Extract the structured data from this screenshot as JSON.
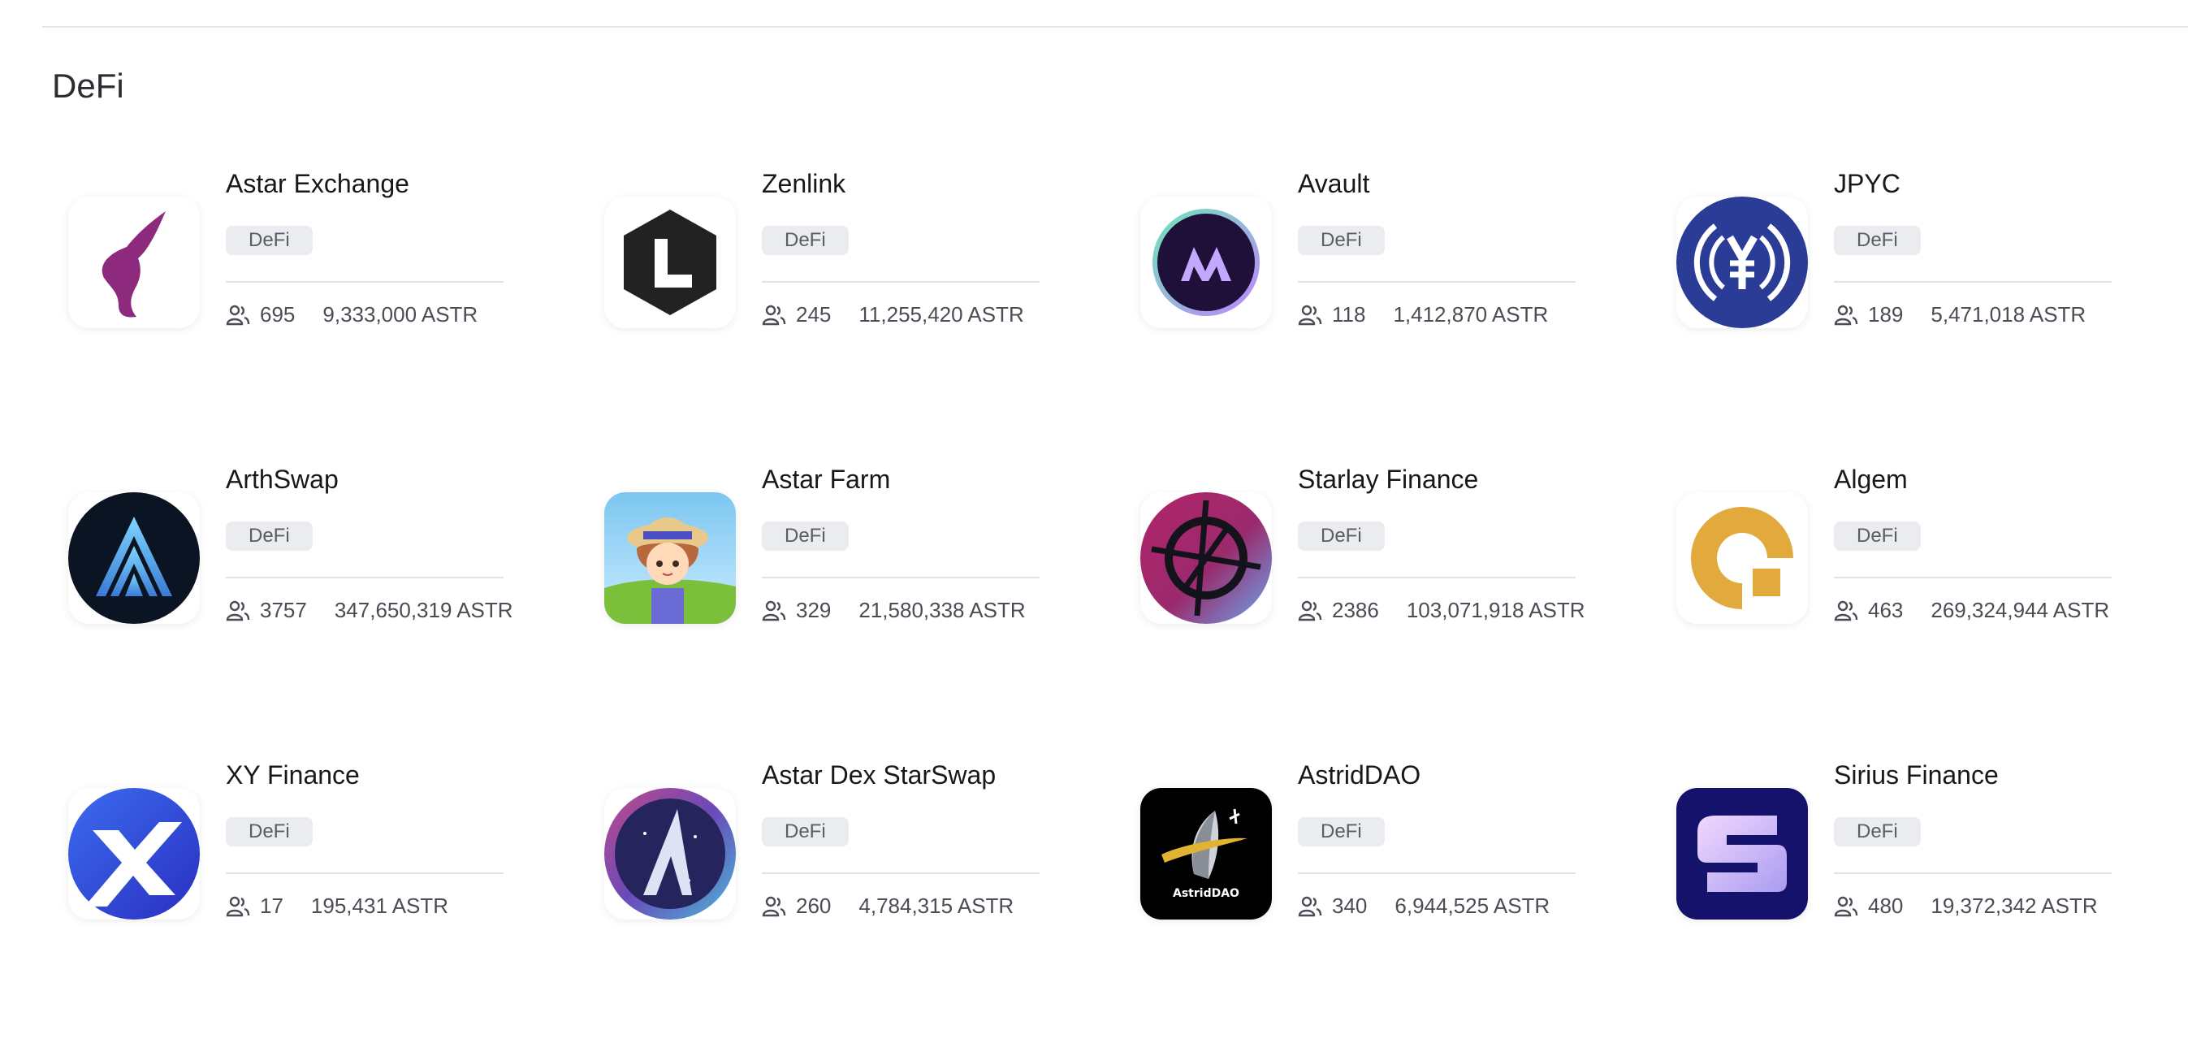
{
  "section": {
    "title": "DeFi"
  },
  "dapps": [
    {
      "name": "Astar Exchange",
      "tag": "DeFi",
      "users": "695",
      "stake": "9,333,000 ASTR",
      "logo": "unicorn-logo-icon",
      "color": "#8e2a7e"
    },
    {
      "name": "Zenlink",
      "tag": "DeFi",
      "users": "245",
      "stake": "11,255,420 ASTR",
      "logo": "hexagon-l-logo-icon",
      "color": "#222222"
    },
    {
      "name": "Avault",
      "tag": "DeFi",
      "users": "118",
      "stake": "1,412,870 ASTR",
      "logo": "avault-logo-icon",
      "color": "#2a1452"
    },
    {
      "name": "JPYC",
      "tag": "DeFi",
      "users": "189",
      "stake": "5,471,018 ASTR",
      "logo": "yen-coin-logo-icon",
      "color": "#2a3c96"
    },
    {
      "name": "ArthSwap",
      "tag": "DeFi",
      "users": "3757",
      "stake": "347,650,319 ASTR",
      "logo": "arthswap-logo-icon",
      "color": "#0b1422"
    },
    {
      "name": "Astar Farm",
      "tag": "DeFi",
      "users": "329",
      "stake": "21,580,338 ASTR",
      "logo": "farm-girl-logo-icon",
      "color": "#7cc6f0"
    },
    {
      "name": "Starlay Finance",
      "tag": "DeFi",
      "users": "2386",
      "stake": "103,071,918 ASTR",
      "logo": "starlay-logo-icon",
      "color": "#b3246a"
    },
    {
      "name": "Algem",
      "tag": "DeFi",
      "users": "463",
      "stake": "269,324,944 ASTR",
      "logo": "algem-logo-icon",
      "color": "#e2a93c"
    },
    {
      "name": "XY Finance",
      "tag": "DeFi",
      "users": "17",
      "stake": "195,431 ASTR",
      "logo": "xy-finance-logo-icon",
      "color": "#2b49d6"
    },
    {
      "name": "Astar Dex StarSwap",
      "tag": "DeFi",
      "users": "260",
      "stake": "4,784,315 ASTR",
      "logo": "starswap-logo-icon",
      "color": "#2b2a6e"
    },
    {
      "name": "AstridDAO",
      "tag": "DeFi",
      "users": "340",
      "stake": "6,944,525 ASTR",
      "logo": "astriddao-logo-icon",
      "logo_text": "AstridDAO",
      "color": "#000000"
    },
    {
      "name": "Sirius Finance",
      "tag": "DeFi",
      "users": "480",
      "stake": "19,372,342 ASTR",
      "logo": "sirius-logo-icon",
      "color": "#14126a"
    }
  ]
}
